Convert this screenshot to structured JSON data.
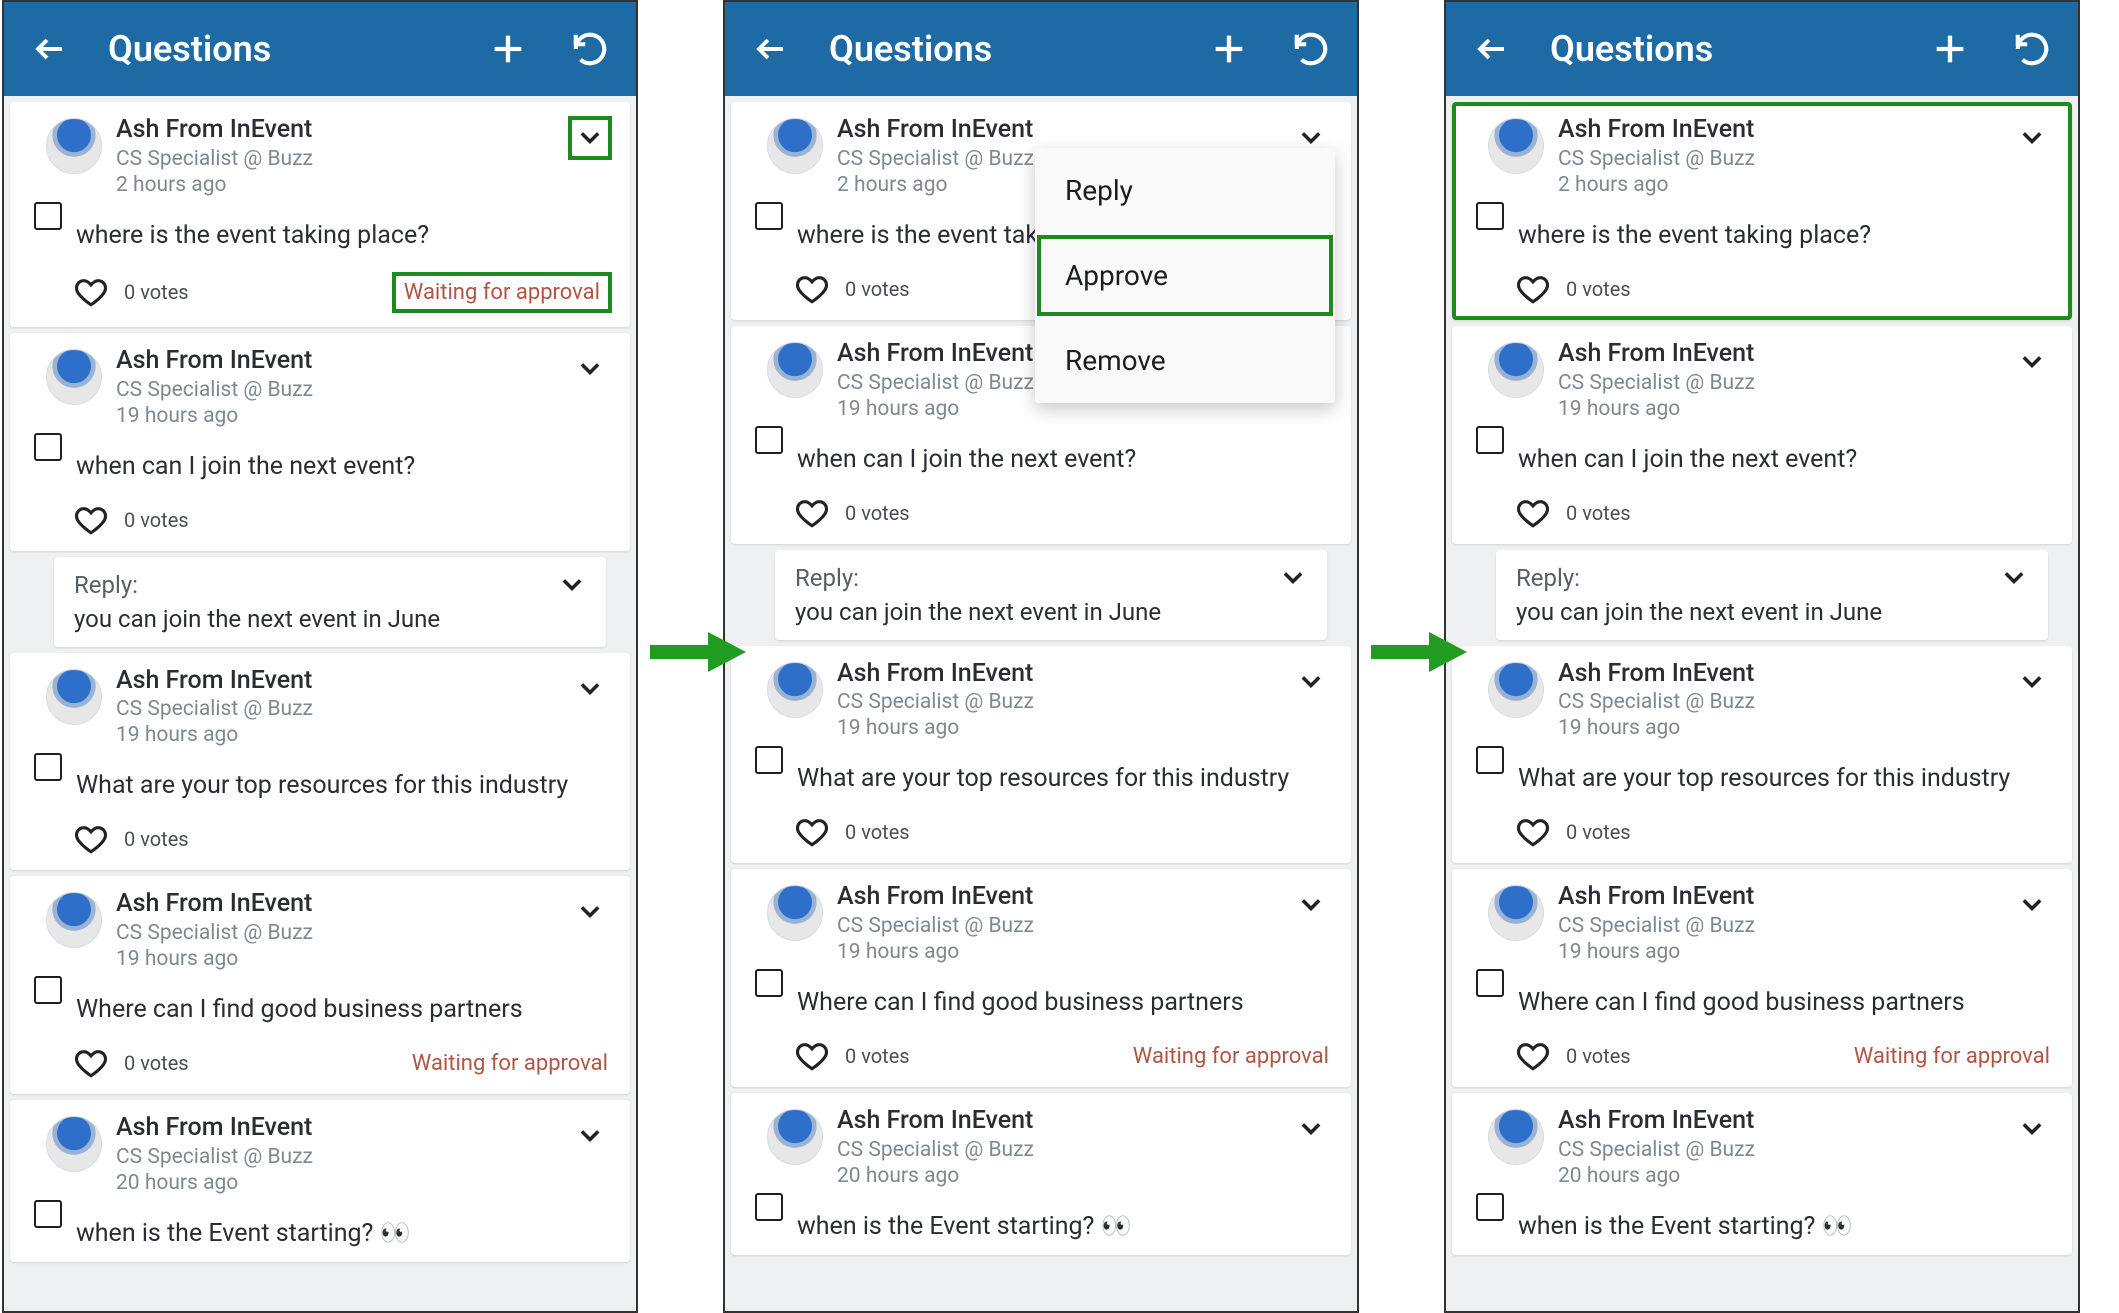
{
  "arrow_color": "#219c21",
  "header": {
    "title": "Questions"
  },
  "menu": {
    "reply": "Reply",
    "approve": "Approve",
    "remove": "Remove"
  },
  "reply": {
    "label": "Reply:",
    "body": "you can join the next event in June"
  },
  "q": [
    {
      "author": "Ash From InEvent",
      "role": "CS Specialist @ Buzz",
      "time": "2 hours ago",
      "text": "where is the event taking place?",
      "votes": "0 votes",
      "waiting": "Waiting for approval"
    },
    {
      "author": "Ash From InEvent",
      "role": "CS Specialist @ Buzz",
      "time": "19 hours ago",
      "text": "when can I join the next event?",
      "votes": "0 votes"
    },
    {
      "author": "Ash From InEvent",
      "role": "CS Specialist @ Buzz",
      "time": "19 hours ago",
      "text": "What are your top resources for this industry",
      "votes": "0 votes"
    },
    {
      "author": "Ash From InEvent",
      "role": "CS Specialist @ Buzz",
      "time": "19 hours ago",
      "text": "Where can I find good business partners",
      "votes": "0 votes",
      "waiting": "Waiting for approval"
    },
    {
      "author": "Ash From InEvent",
      "role": "CS Specialist @ Buzz",
      "time": "20 hours ago",
      "text": "when is the Event starting? 👀",
      "votes": "0 votes"
    }
  ]
}
